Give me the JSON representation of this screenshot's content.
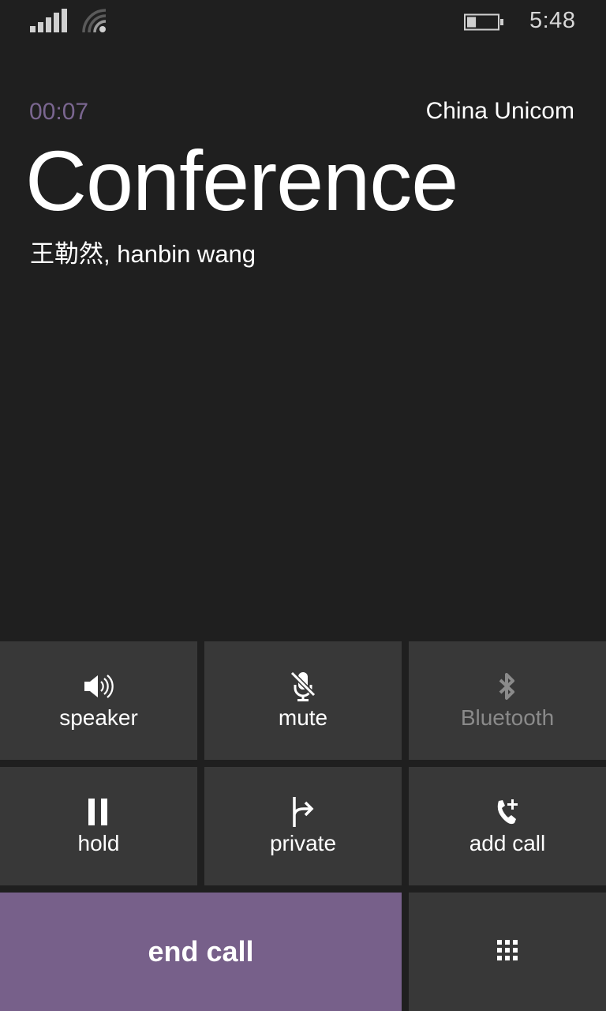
{
  "status_bar": {
    "signal_icon": "cellular-signal-icon",
    "signal_bars": 5,
    "wifi_icon": "wifi-icon",
    "battery_icon": "battery-icon",
    "battery_level_fraction": 0.3,
    "time": "5:48"
  },
  "call": {
    "duration": "00:07",
    "carrier": "China Unicom",
    "title": "Conference",
    "participants": "王勒然, hanbin wang",
    "accent_color": "#77608a"
  },
  "controls": [
    {
      "id": "speaker",
      "label": "speaker",
      "icon": "speaker-icon",
      "enabled": true
    },
    {
      "id": "mute",
      "label": "mute",
      "icon": "microphone-muted-icon",
      "enabled": true
    },
    {
      "id": "bluetooth",
      "label": "Bluetooth",
      "icon": "bluetooth-icon",
      "enabled": false
    },
    {
      "id": "hold",
      "label": "hold",
      "icon": "pause-icon",
      "enabled": true
    },
    {
      "id": "private",
      "label": "private",
      "icon": "split-arrow-icon",
      "enabled": true
    },
    {
      "id": "add_call",
      "label": "add call",
      "icon": "phone-add-icon",
      "enabled": true
    }
  ],
  "end_call": {
    "label": "end call"
  },
  "keypad": {
    "icon": "keypad-icon"
  }
}
